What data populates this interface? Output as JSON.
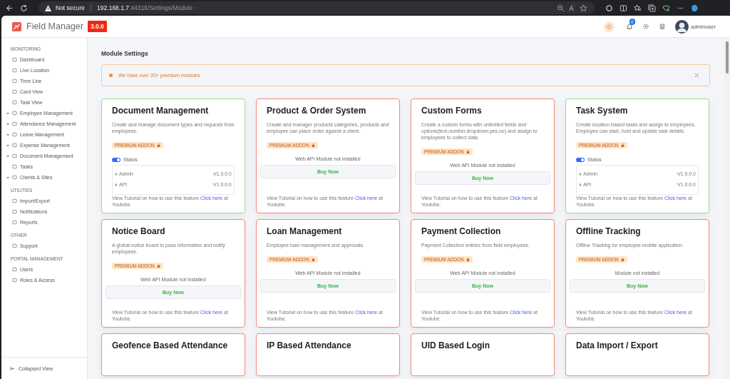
{
  "browser": {
    "security": "Not secure",
    "url_host": "192.168.1.7",
    "url_path": ":44316/Settings/Module"
  },
  "header": {
    "app_name": "Field Manager",
    "version": "3.0.0",
    "notification_count": "0",
    "username": "adminuser"
  },
  "sidebar": {
    "sections": [
      {
        "title": "MONITORING",
        "items": [
          {
            "label": "Dashboard",
            "expandable": false
          },
          {
            "label": "Live Location",
            "expandable": false
          },
          {
            "label": "Time Line",
            "expandable": false
          },
          {
            "label": "Card View",
            "expandable": false
          },
          {
            "label": "Task View",
            "expandable": false
          },
          {
            "label": "Employee Management",
            "expandable": true
          },
          {
            "label": "Attendance Management",
            "expandable": true
          },
          {
            "label": "Leave Management",
            "expandable": true
          },
          {
            "label": "Expense Management",
            "expandable": true
          },
          {
            "label": "Document Management",
            "expandable": true
          },
          {
            "label": "Tasks",
            "expandable": false
          },
          {
            "label": "Clients & Sites",
            "expandable": true
          }
        ]
      },
      {
        "title": "UTILITIES",
        "items": [
          {
            "label": "Import/Export",
            "expandable": false
          },
          {
            "label": "Notifications",
            "expandable": false
          },
          {
            "label": "Reports",
            "expandable": false
          }
        ]
      },
      {
        "title": "OTHER",
        "items": [
          {
            "label": "Support",
            "expandable": false
          }
        ]
      },
      {
        "title": "PORTAL MANAGEMENT",
        "items": [
          {
            "label": "Users",
            "expandable": false
          },
          {
            "label": "Roles & Access",
            "expandable": false
          }
        ]
      }
    ],
    "footer": "Collapsed View"
  },
  "page": {
    "title": "Module Settings",
    "alert": "We have over 20+ premium modules"
  },
  "modules": [
    {
      "kind": "installed",
      "title": "Document Management",
      "description": "Create and manage document types and requests from employees.",
      "badge": "PREMIUM ADDON",
      "status_label": "Status",
      "status_on": true,
      "components": [
        {
          "name": "Admin",
          "version": "V1.0.0.0"
        },
        {
          "name": "API",
          "version": "V1.0.0.0"
        }
      ],
      "tutorial": {
        "before": "View Tutorial on how to use this feature ",
        "link": "Click here",
        "after": " at Youtube."
      }
    },
    {
      "kind": "not_installed",
      "title": "Product & Order System",
      "description": "Create and manager products categories, products and employee can place order against a client.",
      "badge": "PREMIUM ADDON",
      "message": "Web API Module not installed",
      "button": "Buy Now",
      "tutorial": {
        "before": "View Tutorial on how to use this feature ",
        "link": "Click here",
        "after": " at Youtube."
      }
    },
    {
      "kind": "not_installed",
      "title": "Custom Forms",
      "description": "Create a custom forms with unlimited fields and options(text,number,dropdown,yes,no) and assign to employees to collect data.",
      "badge": "PREMIUM ADDON",
      "message": "Web API Module not installed",
      "button": "Buy Now",
      "tutorial": {
        "before": "View Tutorial on how to use this feature ",
        "link": "Click here",
        "after": " at Youtube."
      }
    },
    {
      "kind": "installed",
      "title": "Task System",
      "description": "Create location based tasks and assign to employees. Employee can start, hold and update task details.",
      "badge": "PREMIUM ADDON",
      "status_label": "Status",
      "status_on": true,
      "components": [
        {
          "name": "Admin",
          "version": "V1.0.0.0"
        },
        {
          "name": "API",
          "version": "V1.0.0.0"
        }
      ],
      "tutorial": {
        "before": "View Tutorial on how to use this feature ",
        "link": "Click here",
        "after": " at Youtube."
      }
    },
    {
      "kind": "not_installed",
      "title": "Notice Board",
      "description": "A global notice board to pass information and notify employees.",
      "badge": "PREMIUM ADDON",
      "message": "Web API Module not installed",
      "button": "Buy Now",
      "tutorial": {
        "before": "View Tutorial on how to use this feature ",
        "link": "Click here",
        "after": " at Youtube."
      }
    },
    {
      "kind": "not_installed",
      "title": "Loan Management",
      "description": "Employee loan management and approvals.",
      "badge": "PREMIUM ADDON",
      "message": "Web API Module not installed",
      "button": "Buy Now",
      "tutorial": {
        "before": "View Tutorial on how to use this feature ",
        "link": "Click here",
        "after": " at Youtube."
      }
    },
    {
      "kind": "not_installed",
      "title": "Payment Collection",
      "description": "Payment Collection entries from field employees.",
      "badge": "PREMIUM ADDON",
      "message": "Web API Module not installed",
      "button": "Buy Now",
      "tutorial": {
        "before": "View Tutorial on how to use this feature ",
        "link": "Click here",
        "after": " at Youtube."
      }
    },
    {
      "kind": "not_installed",
      "title": "Offline Tracking",
      "description": "Offline Tracking for employee mobile application.",
      "badge": "PREMIUM ADDON",
      "message": "Module not installed",
      "button": "Buy Now",
      "tutorial": {
        "before": "View Tutorial on how to use this feature ",
        "link": "Click here",
        "after": " at Youtube."
      }
    },
    {
      "kind": "cut_off",
      "title": "Geofence Based Attendance"
    },
    {
      "kind": "cut_off",
      "title": "IP Based Attendance"
    },
    {
      "kind": "cut_off",
      "title": "UID Based Login"
    },
    {
      "kind": "cut_off",
      "title": "Data Import / Export"
    }
  ]
}
